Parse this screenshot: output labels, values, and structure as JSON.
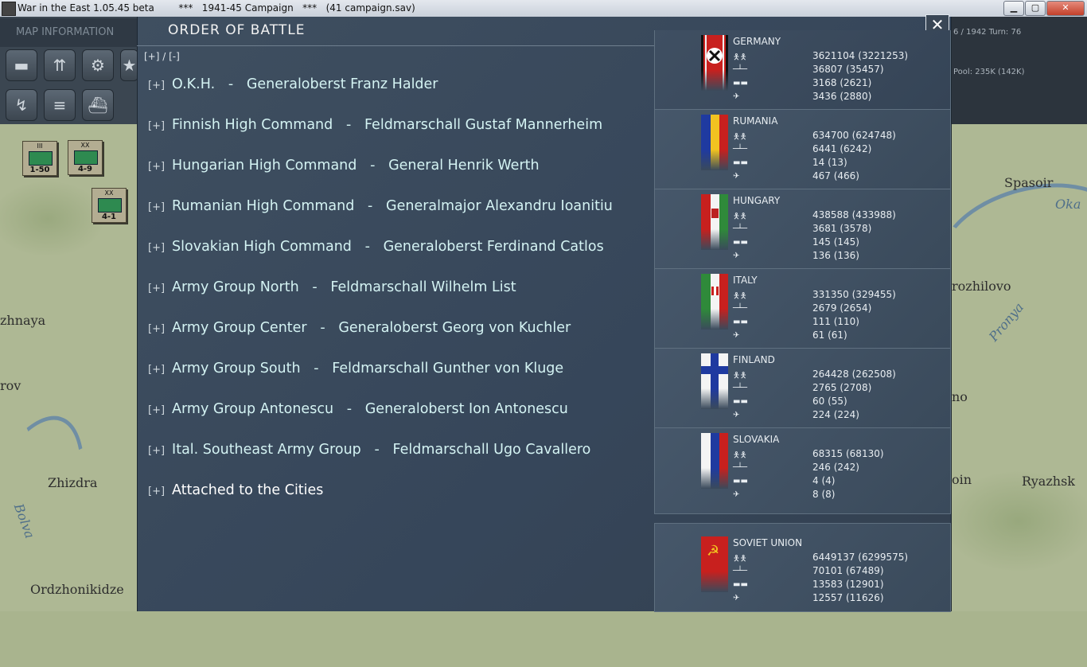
{
  "window": {
    "app_title": "War in the East 1.05.45 beta",
    "campaign": "***   1941-45 Campaign   ***",
    "save": "(41 campaign.sav)"
  },
  "left_panel": {
    "map_info_label": "MAP INFORMATION",
    "counters": [
      {
        "size": "III",
        "strength": "1-50"
      },
      {
        "size": "XX",
        "strength": "4-9"
      },
      {
        "size": "XX",
        "strength": "4-1"
      }
    ],
    "tool_icons": [
      "tank-icon",
      "infantry-icon",
      "gear-icon",
      "star-icon",
      "route-icon",
      "rail-icon",
      "ship-icon"
    ]
  },
  "right_panel": {
    "date_turn": "6 / 1942   Turn: 76",
    "pool": "Pool:  235K  (142K)"
  },
  "map_labels": [
    "Spasoir",
    "Oka",
    "rozhilovo",
    "Pronya",
    "zhnaya",
    "rov",
    "no",
    "Zhizdra",
    "Bolva",
    "oin",
    "Ryazhsk",
    "Ordzhonikidze"
  ],
  "dialog": {
    "title": "ORDER OF BATTLE",
    "expand_collapse": "[+]  /  [-]",
    "close_label": "✕",
    "commands": [
      {
        "pm": "[+]",
        "name": "O.K.H.",
        "commander": "Generaloberst Franz Halder"
      },
      {
        "pm": "[+]",
        "name": "Finnish High Command",
        "commander": "Feldmarschall Gustaf Mannerheim"
      },
      {
        "pm": "[+]",
        "name": "Hungarian High Command",
        "commander": "General Henrik Werth"
      },
      {
        "pm": "[+]",
        "name": "Rumanian High Command",
        "commander": "Generalmajor Alexandru Ioanitiu"
      },
      {
        "pm": "[+]",
        "name": "Slovakian High Command",
        "commander": "Generaloberst Ferdinand Catlos"
      },
      {
        "pm": "[+]",
        "name": "Army Group North",
        "commander": "Feldmarschall Wilhelm List"
      },
      {
        "pm": "[+]",
        "name": "Army Group Center",
        "commander": "Generaloberst Georg von Kuchler"
      },
      {
        "pm": "[+]",
        "name": "Army Group South",
        "commander": "Feldmarschall Gunther von Kluge"
      },
      {
        "pm": "[+]",
        "name": "Army Group Antonescu",
        "commander": "Generaloberst Ion Antonescu"
      },
      {
        "pm": "[+]",
        "name": "Ital. Southeast Army Group",
        "commander": "Feldmarschall Ugo Cavallero"
      }
    ],
    "attached": {
      "pm": "[+]",
      "label": "Attached to the Cities"
    }
  },
  "nations": [
    {
      "name": "GERMANY",
      "flag": "germany-flag",
      "men": "3621104 (3221253)",
      "guns": "36807 (35457)",
      "afv": "3168 (2621)",
      "aircraft": "3436 (2880)"
    },
    {
      "name": "RUMANIA",
      "flag": "rumania-flag",
      "men": "634700 (624748)",
      "guns": "6441 (6242)",
      "afv": "14 (13)",
      "aircraft": "467 (466)"
    },
    {
      "name": "HUNGARY",
      "flag": "hungary-flag",
      "men": "438588 (433988)",
      "guns": "3681 (3578)",
      "afv": "145 (145)",
      "aircraft": "136 (136)"
    },
    {
      "name": "ITALY",
      "flag": "italy-flag",
      "men": "331350 (329455)",
      "guns": "2679 (2654)",
      "afv": "111 (110)",
      "aircraft": "61 (61)"
    },
    {
      "name": "FINLAND",
      "flag": "finland-flag",
      "men": "264428 (262508)",
      "guns": "2765 (2708)",
      "afv": "60 (55)",
      "aircraft": "224 (224)"
    },
    {
      "name": "SLOVAKIA",
      "flag": "slovakia-flag",
      "men": "68315 (68130)",
      "guns": "246 (242)",
      "afv": "4 (4)",
      "aircraft": "8 (8)"
    },
    {
      "name": "SOVIET UNION",
      "flag": "soviet-flag",
      "men": "6449137 (6299575)",
      "guns": "70101 (67489)",
      "afv": "13583 (12901)",
      "aircraft": "12557 (11626)"
    }
  ],
  "colors": {
    "dialog_bg": "#3b4b5c",
    "command_text": "#d4f3f3",
    "panel_border": "#5f7080"
  }
}
